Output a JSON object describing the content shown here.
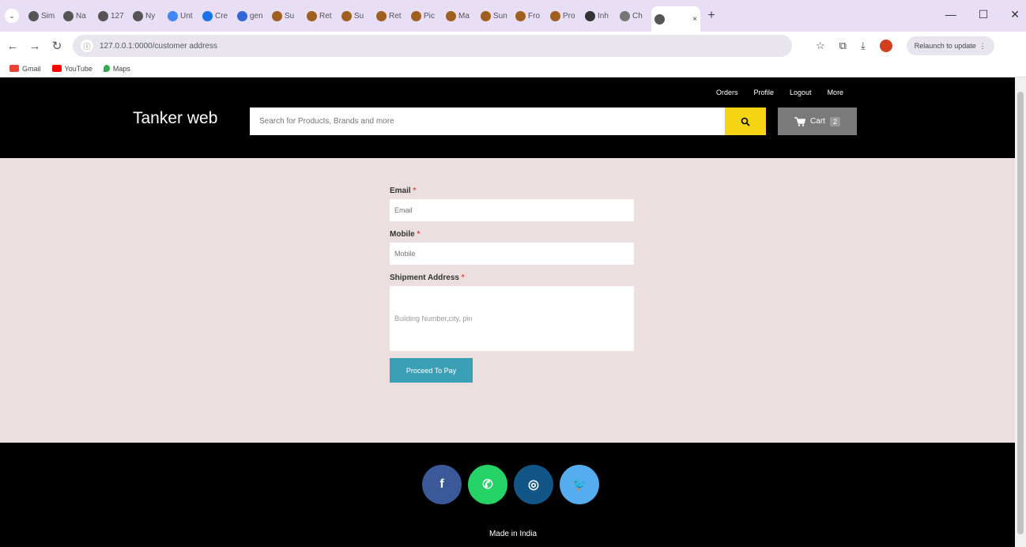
{
  "browser": {
    "tabs": [
      "Sim",
      "Na",
      "127",
      "Ny",
      "Unt",
      "Cre",
      "gen",
      "Su",
      "Ret",
      "Su",
      "Ret",
      "Pic",
      "Ma",
      "Sun",
      "Fro",
      "Pro",
      "Inh",
      "Ch"
    ],
    "active_tab_close": "×",
    "new_tab": "+",
    "url": "127.0.0.1:0000/customer address",
    "relaunch_label": "Relaunch to update",
    "bookmarks": [
      "Gmail",
      "YouTube",
      "Maps"
    ]
  },
  "header": {
    "brand": "Tanker web",
    "nav": [
      "Orders",
      "Profile",
      "Logout",
      "More"
    ],
    "search_placeholder": "Search for Products, Brands and more",
    "cart_label": "Cart",
    "cart_count": "2"
  },
  "form": {
    "email_label": "Email",
    "email_placeholder": "Email",
    "mobile_label": "Mobile",
    "mobile_placeholder": "Mobile",
    "address_label": "Shipment Address",
    "address_placeholder": "Building Number,city, pin",
    "required_mark": "*",
    "submit_label": "Proceed To Pay"
  },
  "footer": {
    "made_in": "Made in India",
    "social": [
      {
        "name": "facebook-icon",
        "glyph": "f",
        "color": "#3b5998"
      },
      {
        "name": "whatsapp-icon",
        "glyph": "✆",
        "color": "#25d366"
      },
      {
        "name": "instagram-icon",
        "glyph": "◎",
        "color": "#125688"
      },
      {
        "name": "twitter-icon",
        "glyph": "🐦",
        "color": "#55acee"
      }
    ]
  },
  "colors": {
    "header_bg": "#000000",
    "main_bg": "#ebdfdf",
    "search_button": "#f5d414",
    "submit_button": "#3aa0b6"
  }
}
